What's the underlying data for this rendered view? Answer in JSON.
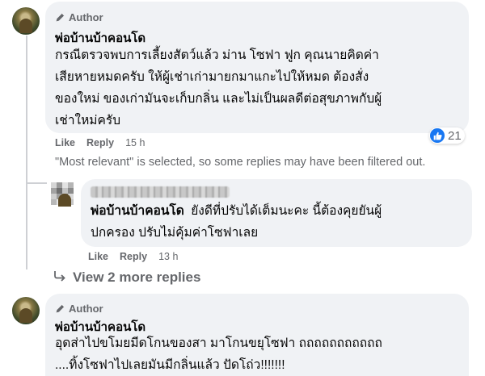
{
  "comments": [
    {
      "badge": "Author",
      "name": "พ่อบ้านบ้าคอนโด",
      "lines": [
        "กรณีตรวจพบการเลี้ยงสัตว์แล้ว ม่าน โซฟา ฟูก คุณนายคิดค่า",
        "เสียหายหมดครับ ให้ผู้เช่าเก่ามายกมาแกะไปให้หมด ต้องสั่ง",
        "ของใหม่ ของเก่ามันจะเก็บกลิ่น และไม่เป็นผลดีต่อสุขภาพกับผู้",
        "เช่าใหม่ครับ"
      ],
      "like_label": "Like",
      "reply_label": "Reply",
      "time": "15 h",
      "reaction_count": "21"
    },
    {
      "name": "พ่อบ้านบ้าคอนโด",
      "lines": [
        "ยังดีที่ปรับได้เต็มนะคะ นี้ต้องคุยยันผู้",
        "ปกครอง ปรับไม่คุ้มค่าโซฟาเลย"
      ],
      "like_label": "Like",
      "reply_label": "Reply",
      "time": "13 h"
    },
    {
      "badge": "Author",
      "name": "พ่อบ้านบ้าคอนโด",
      "lines": [
        "อุดส่าไปขโมยมีดโกนของสา มาโกนขยุโซฟา ถถถถถถถถถถถ",
        "....ทิ้งโซฟาไปเลยมันมีกลิ่นแล้ว ปัดโถ่ว!!!!!!!"
      ]
    }
  ],
  "filter_notice": "\"Most relevant\" is selected, so some replies may have been filtered out.",
  "view_more_label": "View 2 more replies",
  "colors": {
    "bubble": "#f0f2f5",
    "secondary_text": "#65676b",
    "like_blue": "#1877f2"
  },
  "icons": [
    "pencil-icon",
    "like-thumb-icon",
    "reply-arrow-icon"
  ]
}
